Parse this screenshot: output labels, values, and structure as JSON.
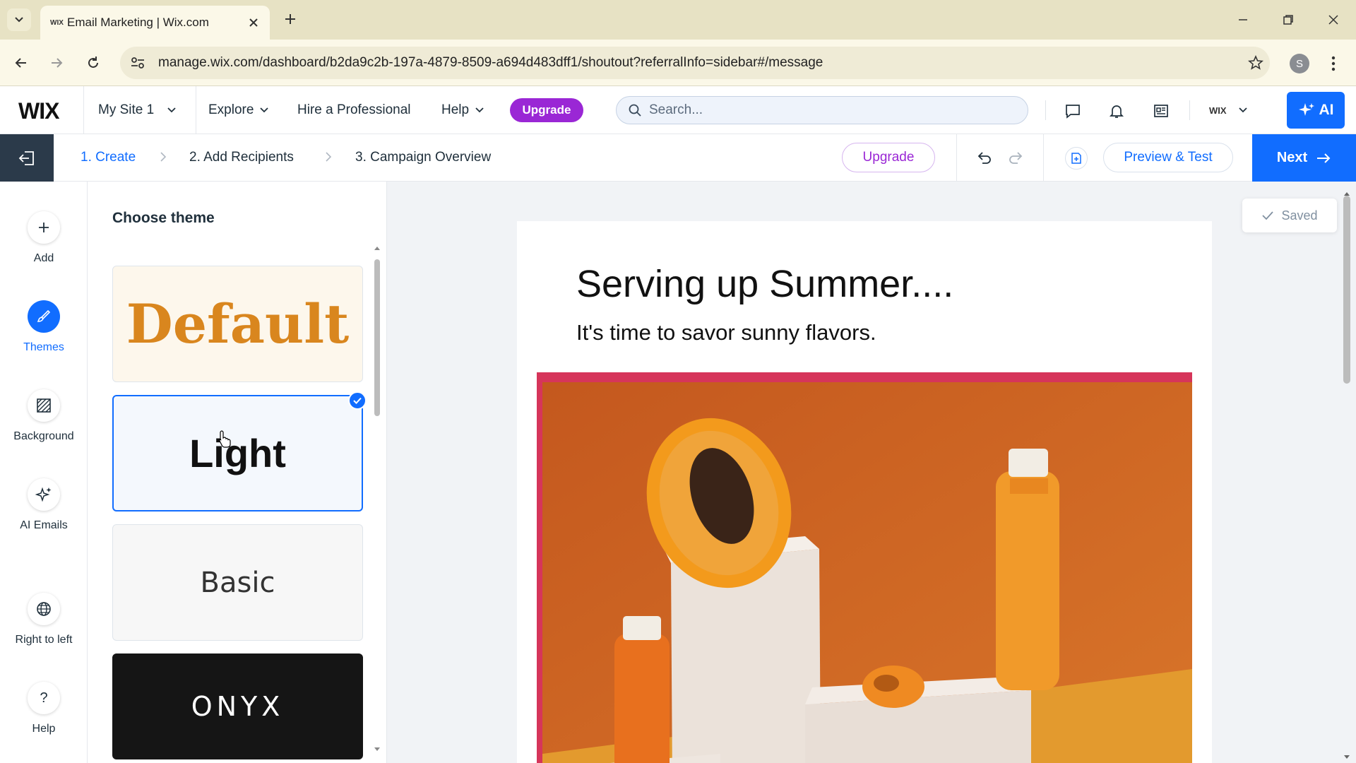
{
  "browser": {
    "tab_title": "Email Marketing | Wix.com",
    "favicon_text": "WIX",
    "url": "manage.wix.com/dashboard/b2da9c2b-197a-4879-8509-a694d483dff1/shoutout?referralInfo=sidebar#/message",
    "profile_initial": "S"
  },
  "header": {
    "logo": "WIX",
    "site_selector": "My Site 1",
    "nav": [
      {
        "label": "Explore"
      },
      {
        "label": "Hire a Professional"
      },
      {
        "label": "Help"
      }
    ],
    "upgrade_label": "Upgrade",
    "search_placeholder": "Search...",
    "account_label": "WIX",
    "ai_label": "AI"
  },
  "steps": {
    "items": [
      {
        "label": "1. Create",
        "active": true
      },
      {
        "label": "2. Add Recipients",
        "active": false
      },
      {
        "label": "3. Campaign Overview",
        "active": false
      }
    ],
    "upgrade_label": "Upgrade",
    "preview_label": "Preview & Test",
    "next_label": "Next"
  },
  "rail": {
    "items": [
      {
        "label": "Add",
        "icon": "plus-icon"
      },
      {
        "label": "Themes",
        "icon": "brush-icon",
        "active": true
      },
      {
        "label": "Background",
        "icon": "background-pattern-icon"
      },
      {
        "label": "AI Emails",
        "icon": "ai-sparkle-icon"
      },
      {
        "label": "Right to left",
        "icon": "globe-icon"
      },
      {
        "label": "Help",
        "icon": "question-icon"
      }
    ]
  },
  "panel": {
    "title": "Choose theme",
    "themes": [
      {
        "label": "Default",
        "selected": false
      },
      {
        "label": "Light",
        "selected": true
      },
      {
        "label": "Basic",
        "selected": false
      },
      {
        "label": "ONYX",
        "selected": false
      }
    ]
  },
  "email": {
    "headline": "Serving up Summer....",
    "subheadline": "It's time to savor sunny flavors."
  },
  "status": {
    "saved_label": "Saved"
  },
  "colors": {
    "accent": "#116dff",
    "upgrade_purple": "#9a27d5",
    "image_border": "#d6355a"
  }
}
